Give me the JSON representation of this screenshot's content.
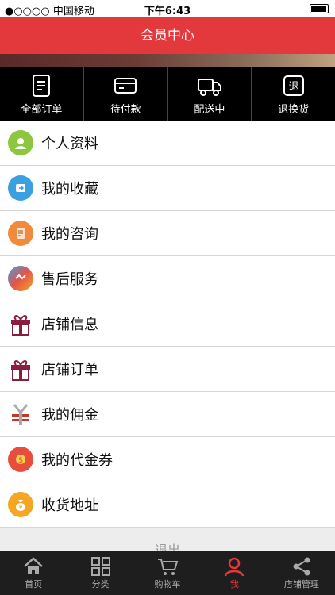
{
  "status": {
    "carrier": "●○○○○ 中国移动",
    "time": "下午6:43",
    "battery": "🔒"
  },
  "header": {
    "title": "会员中心"
  },
  "orders": [
    {
      "label": "全部订单",
      "icon": "document-icon"
    },
    {
      "label": "待付款",
      "icon": "card-icon"
    },
    {
      "label": "配送中",
      "icon": "truck-icon"
    },
    {
      "label": "退换货",
      "icon": "return-icon"
    }
  ],
  "menu": [
    {
      "label": "个人资料",
      "icon": "profile-icon",
      "color": "#8dc63f"
    },
    {
      "label": "我的收藏",
      "icon": "favorite-icon",
      "color": "#3aa0e0"
    },
    {
      "label": "我的咨询",
      "icon": "consult-icon",
      "color": "#f08a3c"
    },
    {
      "label": "售后服务",
      "icon": "after-sale-icon",
      "color": "#e5544b"
    },
    {
      "label": "店铺信息",
      "icon": "gift-icon",
      "color": "#8b1e3f"
    },
    {
      "label": "店铺订单",
      "icon": "gift-icon",
      "color": "#8b1e3f"
    },
    {
      "label": "我的佣金",
      "icon": "yen-icon",
      "color": "#c0392b"
    },
    {
      "label": "我的代金券",
      "icon": "coupon-icon",
      "color": "#e84e3c"
    },
    {
      "label": "收货地址",
      "icon": "money-bag-icon",
      "color": "#f5a623"
    }
  ],
  "logout_label": "退出",
  "tabs": [
    {
      "label": "首页",
      "icon": "home-icon",
      "active": false
    },
    {
      "label": "分类",
      "icon": "category-icon",
      "active": false
    },
    {
      "label": "购物车",
      "icon": "cart-icon",
      "active": false
    },
    {
      "label": "我",
      "icon": "user-icon",
      "active": true
    },
    {
      "label": "店铺管理",
      "icon": "share-icon",
      "active": false
    }
  ]
}
